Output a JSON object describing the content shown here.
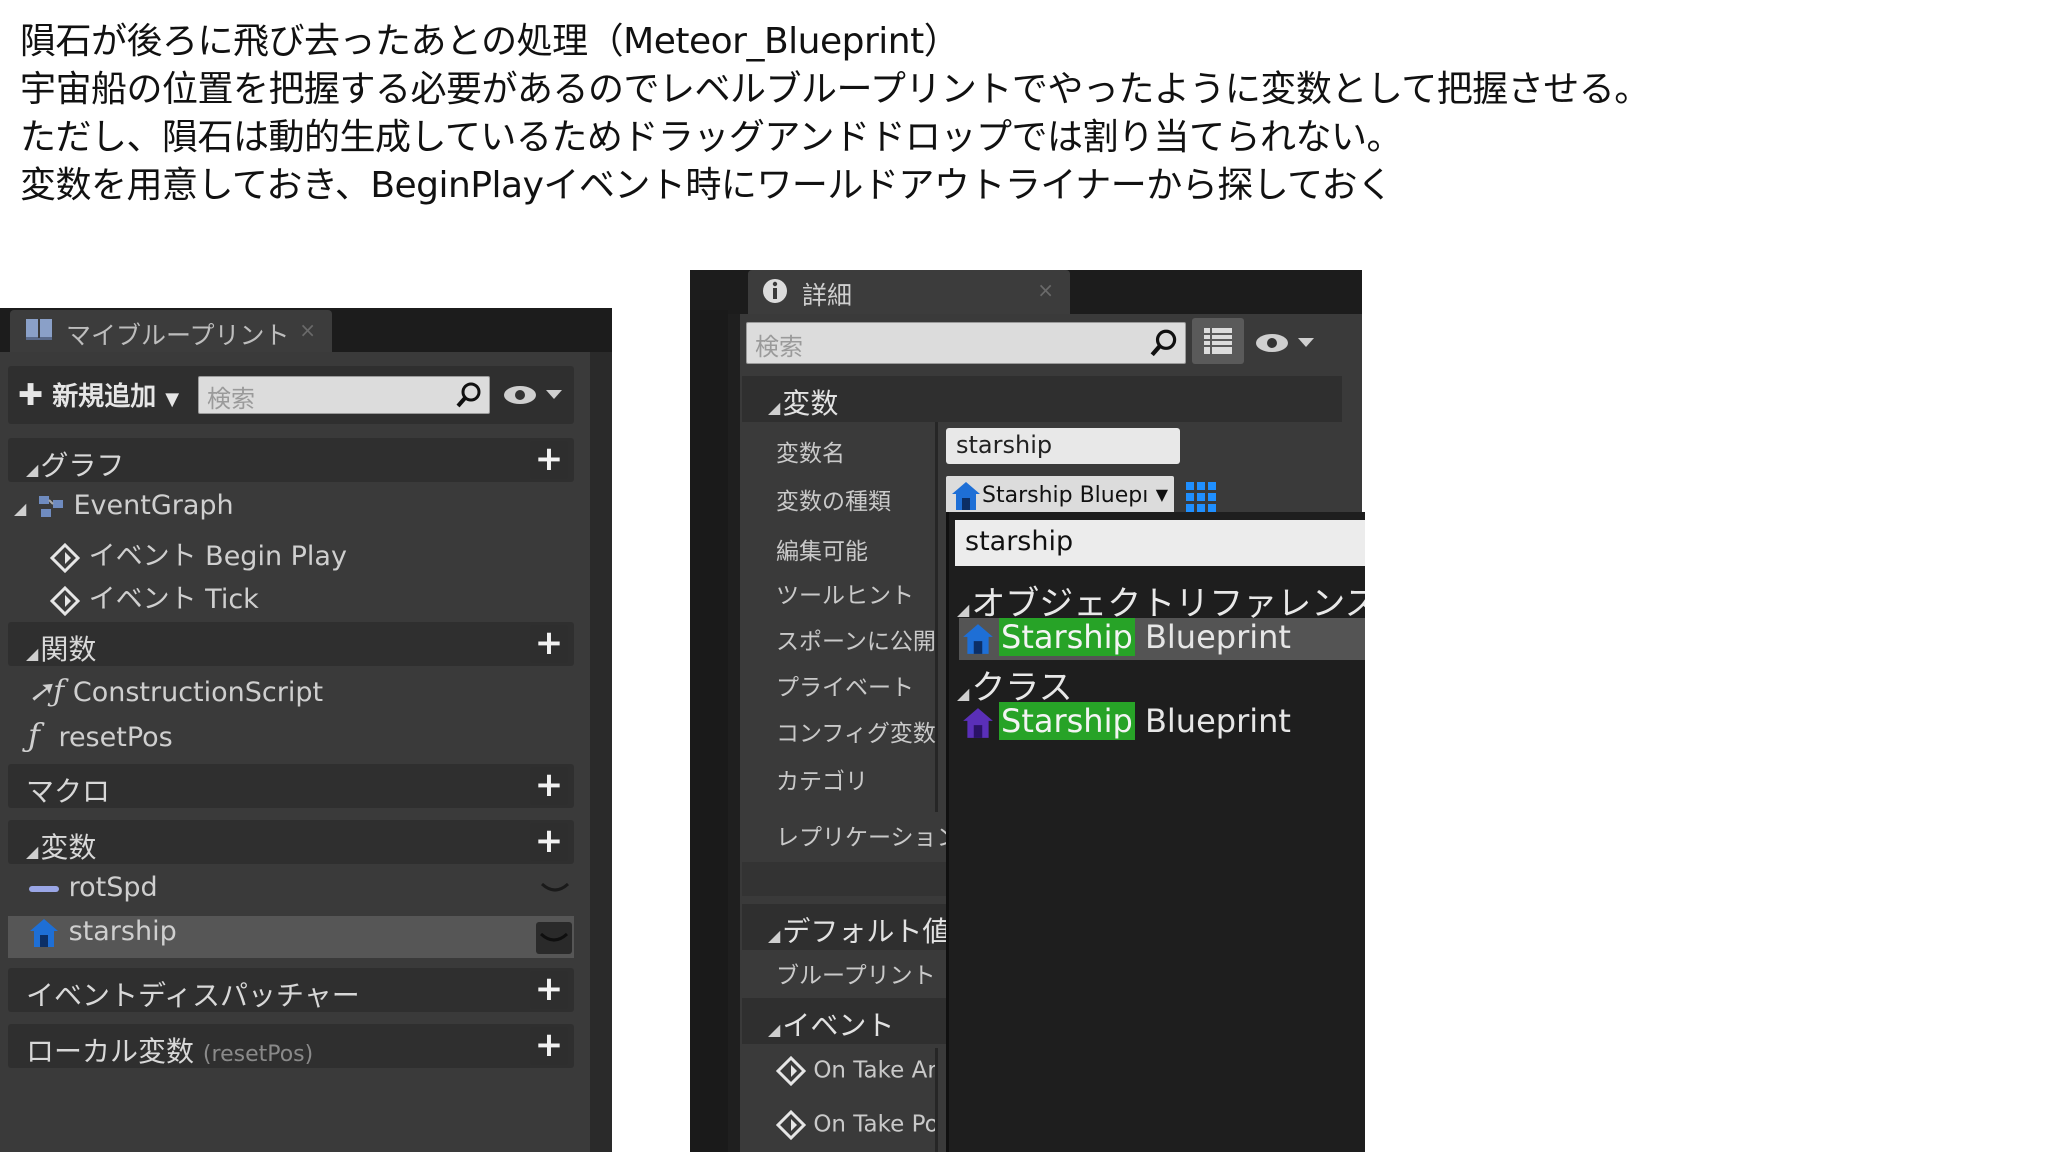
{
  "intro": {
    "lines": [
      "隕石が後ろに飛び去ったあとの処理（Meteor_Blueprint）",
      "宇宙船の位置を把握する必要があるのでレベルブループリントでやったように変数として把握させる。",
      "ただし、隕石は動的生成しているためドラッグアンドドロップでは割り当てられない。",
      "変数を用意しておき、BeginPlayイベント時にワールドアウトライナーから探しておく"
    ]
  },
  "my_blueprint": {
    "tab_label": "マイブループリント",
    "tab_close": "×",
    "add_new": "新規追加",
    "search_placeholder": "検索",
    "sections": {
      "graph": "グラフ",
      "functions": "関数",
      "macros": "マクロ",
      "variables": "変数",
      "dispatchers": "イベントディスパッチャー",
      "local_vars": "ローカル変数",
      "local_vars_scope": "(resetPos)"
    },
    "graph_items": {
      "event_graph": "EventGraph",
      "begin_play": "イベント Begin Play",
      "tick": "イベント Tick"
    },
    "function_items": [
      "ConstructionScript",
      "resetPos"
    ],
    "variable_items": [
      "rotSpd",
      "starship"
    ]
  },
  "details": {
    "tab_label": "詳細",
    "tab_close": "×",
    "search_placeholder": "検索",
    "section_variable": "変数",
    "props": {
      "name_label": "変数名",
      "name_value": "starship",
      "type_label": "変数の種類",
      "type_value": "Starship Bluepı",
      "editable": "編集可能",
      "tooltip": "ツールヒント",
      "expose_spawn": "スポーンに公開",
      "private": "プライベート",
      "config": "コンフィグ変数",
      "category": "カテゴリ",
      "replication": "レプリケーション"
    },
    "section_default": "デフォルト値",
    "default_row": "ブループリント",
    "section_events": "イベント",
    "event_items": [
      "On Take Ar",
      "On Take Po"
    ]
  },
  "type_dropdown": {
    "search_value": "starship",
    "categories": [
      "オブジェクトリファレンス",
      "クラス"
    ],
    "results": [
      {
        "match": "Starship",
        "rest": "Blueprint"
      },
      {
        "match": "Starship",
        "rest": "Blueprint"
      }
    ]
  },
  "colors": {
    "panel_bg": "#3a3a3a",
    "section_bg": "#2f2f2f",
    "highlight_green": "#27a327",
    "selection_row": "#565656"
  }
}
